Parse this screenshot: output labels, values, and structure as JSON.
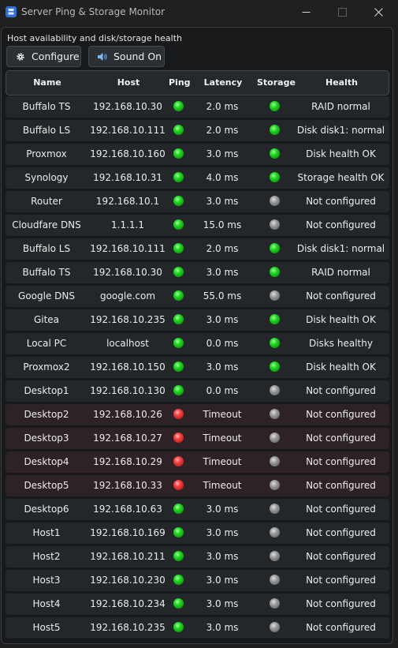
{
  "window": {
    "title": "Server Ping & Storage Monitor",
    "min_icon": "minimize-icon",
    "max_icon": "maximize-icon",
    "close_icon": "close-icon"
  },
  "subtitle": "Host availability and disk/storage health",
  "toolbar": {
    "configure_label": "Configure",
    "configure_icon": "gear-icon",
    "sound_label": "Sound On",
    "sound_icon": "speaker-icon"
  },
  "table": {
    "headers": [
      "Name",
      "Host",
      "Ping",
      "Latency",
      "Storage",
      "Health"
    ],
    "status_colors": {
      "green": "#22d322",
      "red": "#ef4040",
      "gray": "#9a9a9a"
    },
    "rows": [
      {
        "name": "Buffalo TS",
        "host": "192.168.10.30",
        "ping": "green",
        "latency": "2.0 ms",
        "storage": "green",
        "health": "RAID normal",
        "alert": false
      },
      {
        "name": "Buffalo LS",
        "host": "192.168.10.111",
        "ping": "green",
        "latency": "2.0 ms",
        "storage": "green",
        "health": "Disk disk1: normal",
        "alert": false
      },
      {
        "name": "Proxmox",
        "host": "192.168.10.160",
        "ping": "green",
        "latency": "3.0 ms",
        "storage": "green",
        "health": "Disk health OK",
        "alert": false
      },
      {
        "name": "Synology",
        "host": "192.168.10.31",
        "ping": "green",
        "latency": "4.0 ms",
        "storage": "green",
        "health": "Storage health OK",
        "alert": false
      },
      {
        "name": "Router",
        "host": "192.168.10.1",
        "ping": "green",
        "latency": "3.0 ms",
        "storage": "gray",
        "health": "Not configured",
        "alert": false
      },
      {
        "name": "Cloudfare DNS",
        "host": "1.1.1.1",
        "ping": "green",
        "latency": "15.0 ms",
        "storage": "gray",
        "health": "Not configured",
        "alert": false
      },
      {
        "name": "Buffalo LS",
        "host": "192.168.10.111",
        "ping": "green",
        "latency": "2.0 ms",
        "storage": "green",
        "health": "Disk disk1: normal",
        "alert": false
      },
      {
        "name": "Buffalo TS",
        "host": "192.168.10.30",
        "ping": "green",
        "latency": "3.0 ms",
        "storage": "green",
        "health": "RAID normal",
        "alert": false
      },
      {
        "name": "Google DNS",
        "host": "google.com",
        "ping": "green",
        "latency": "55.0 ms",
        "storage": "gray",
        "health": "Not configured",
        "alert": false
      },
      {
        "name": "Gitea",
        "host": "192.168.10.235",
        "ping": "green",
        "latency": "3.0 ms",
        "storage": "green",
        "health": "Disk health OK",
        "alert": false
      },
      {
        "name": "Local PC",
        "host": "localhost",
        "ping": "green",
        "latency": "0.0 ms",
        "storage": "green",
        "health": "Disks healthy",
        "alert": false
      },
      {
        "name": "Proxmox2",
        "host": "192.168.10.150",
        "ping": "green",
        "latency": "3.0 ms",
        "storage": "green",
        "health": "Disk health OK",
        "alert": false
      },
      {
        "name": "Desktop1",
        "host": "192.168.10.130",
        "ping": "green",
        "latency": "0.0 ms",
        "storage": "gray",
        "health": "Not configured",
        "alert": false
      },
      {
        "name": "Desktop2",
        "host": "192.168.10.26",
        "ping": "red",
        "latency": "Timeout",
        "storage": "gray",
        "health": "Not configured",
        "alert": true
      },
      {
        "name": "Desktop3",
        "host": "192.168.10.27",
        "ping": "red",
        "latency": "Timeout",
        "storage": "gray",
        "health": "Not configured",
        "alert": true
      },
      {
        "name": "Desktop4",
        "host": "192.168.10.29",
        "ping": "red",
        "latency": "Timeout",
        "storage": "gray",
        "health": "Not configured",
        "alert": true
      },
      {
        "name": "Desktop5",
        "host": "192.168.10.33",
        "ping": "red",
        "latency": "Timeout",
        "storage": "gray",
        "health": "Not configured",
        "alert": true
      },
      {
        "name": "Desktop6",
        "host": "192.168.10.63",
        "ping": "green",
        "latency": "3.0 ms",
        "storage": "gray",
        "health": "Not configured",
        "alert": false
      },
      {
        "name": "Host1",
        "host": "192.168.10.169",
        "ping": "green",
        "latency": "3.0 ms",
        "storage": "gray",
        "health": "Not configured",
        "alert": false
      },
      {
        "name": "Host2",
        "host": "192.168.10.211",
        "ping": "green",
        "latency": "3.0 ms",
        "storage": "gray",
        "health": "Not configured",
        "alert": false
      },
      {
        "name": "Host3",
        "host": "192.168.10.230",
        "ping": "green",
        "latency": "3.0 ms",
        "storage": "gray",
        "health": "Not configured",
        "alert": false
      },
      {
        "name": "Host4",
        "host": "192.168.10.234",
        "ping": "green",
        "latency": "3.0 ms",
        "storage": "gray",
        "health": "Not configured",
        "alert": false
      },
      {
        "name": "Host5",
        "host": "192.168.10.235",
        "ping": "green",
        "latency": "3.0 ms",
        "storage": "gray",
        "health": "Not configured",
        "alert": false
      }
    ]
  }
}
